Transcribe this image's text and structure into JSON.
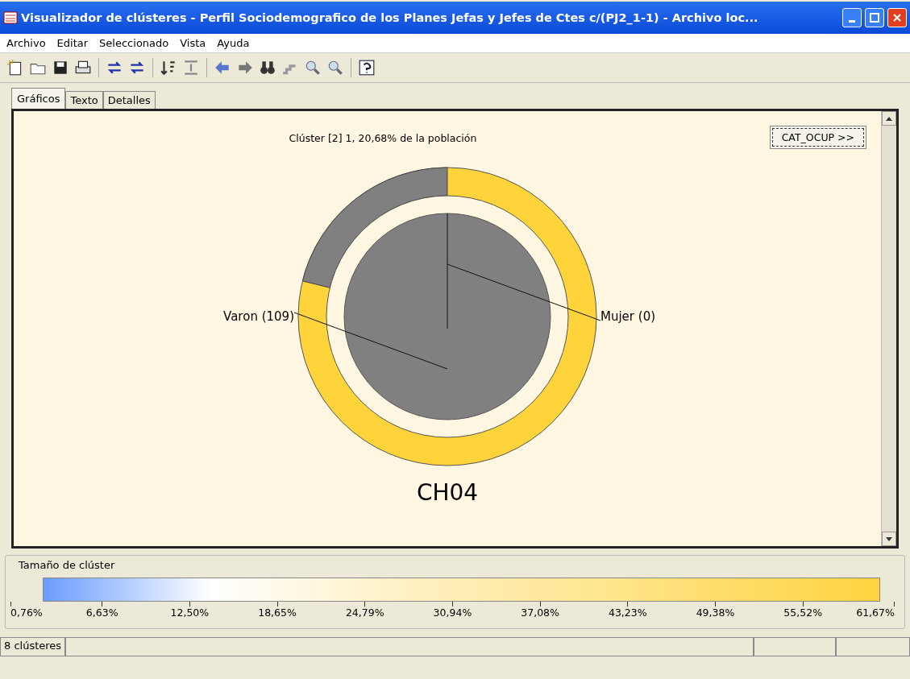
{
  "window": {
    "title": "Visualizador de clústeres - Perfil Sociodemografico de los Planes Jefas y Jefes de Ctes c/(PJ2_1-1) - Archivo loc..."
  },
  "menu": [
    "Archivo",
    "Editar",
    "Seleccionado",
    "Vista",
    "Ayuda"
  ],
  "tabs": [
    {
      "label": "Gráficos",
      "selected": true
    },
    {
      "label": "Texto",
      "selected": false
    },
    {
      "label": "Detalles",
      "selected": false
    }
  ],
  "chart_panel": {
    "title": "Clúster [2] 1, 20,68% de la población",
    "button": "CAT_OCUP >>",
    "labels": [
      "Varon (109)",
      "Mujer (0)"
    ],
    "variable": "CH04"
  },
  "legend": {
    "title": "Tamaño de clúster",
    "ticks": [
      "0,76%",
      "6,63%",
      "12,50%",
      "18,65%",
      "24,79%",
      "30,94%",
      "37,08%",
      "43,23%",
      "49,38%",
      "55,52%",
      "61,67%"
    ]
  },
  "status_bar": [
    "8 clústeres"
  ]
}
